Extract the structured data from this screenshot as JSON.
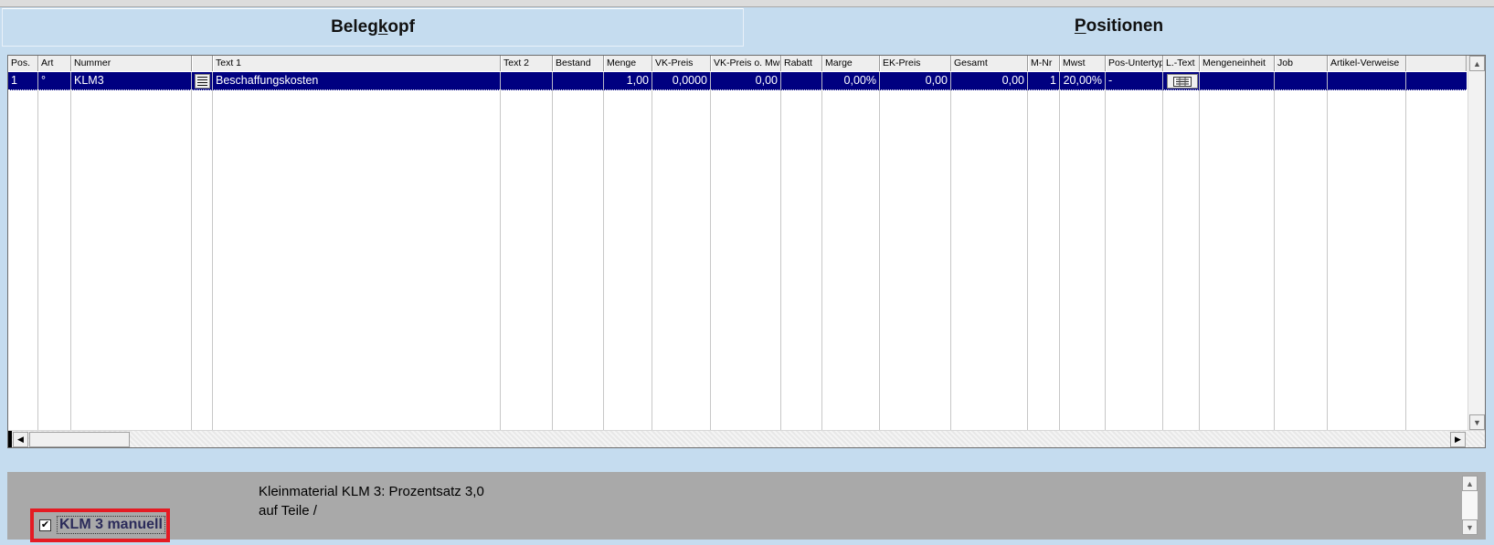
{
  "tabs": {
    "belegkopf": {
      "pre": "Beleg",
      "ul": "k",
      "post": "opf"
    },
    "positionen": {
      "pre": "",
      "ul": "P",
      "post": "ositionen"
    }
  },
  "grid": {
    "columns": [
      "Pos.",
      "Art",
      "Nummer",
      "",
      "Text 1",
      "Text 2",
      "Bestand",
      "Menge",
      "VK-Preis",
      "VK-Preis o. Mwst",
      "Rabatt",
      "Marge",
      "EK-Preis",
      "Gesamt",
      "M-Nr",
      "Mwst",
      "Pos-Untertyp",
      "L.-Text",
      "Mengeneinheit",
      "Job",
      "Artikel-Verweise"
    ],
    "rows": [
      {
        "pos": "1",
        "art": "°",
        "nummer": "KLM3",
        "text1": "Beschaffungskosten",
        "text2": "",
        "bestand": "",
        "menge": "1,00",
        "vk_preis": "0,0000",
        "vk_preis_o_mwst": "0,00",
        "rabatt": "",
        "marge": "0,00%",
        "ek_preis": "0,00",
        "gesamt": "0,00",
        "m_nr": "1",
        "mwst": "20,00%",
        "pos_untertyp": "-",
        "mengeneinheit": "",
        "job": "",
        "artikel_verweise": ""
      }
    ]
  },
  "description": {
    "line1": "Kleinmaterial KLM 3: Prozentsatz 3,0",
    "line2": "auf Teile /"
  },
  "klm_manual": {
    "label": "KLM 3 manuell",
    "checked": true
  },
  "colors": {
    "background": "#c5dcef",
    "selected_row": "#000080",
    "highlight_box": "#e41b23",
    "bottom_panel": "#a9a9a9"
  }
}
